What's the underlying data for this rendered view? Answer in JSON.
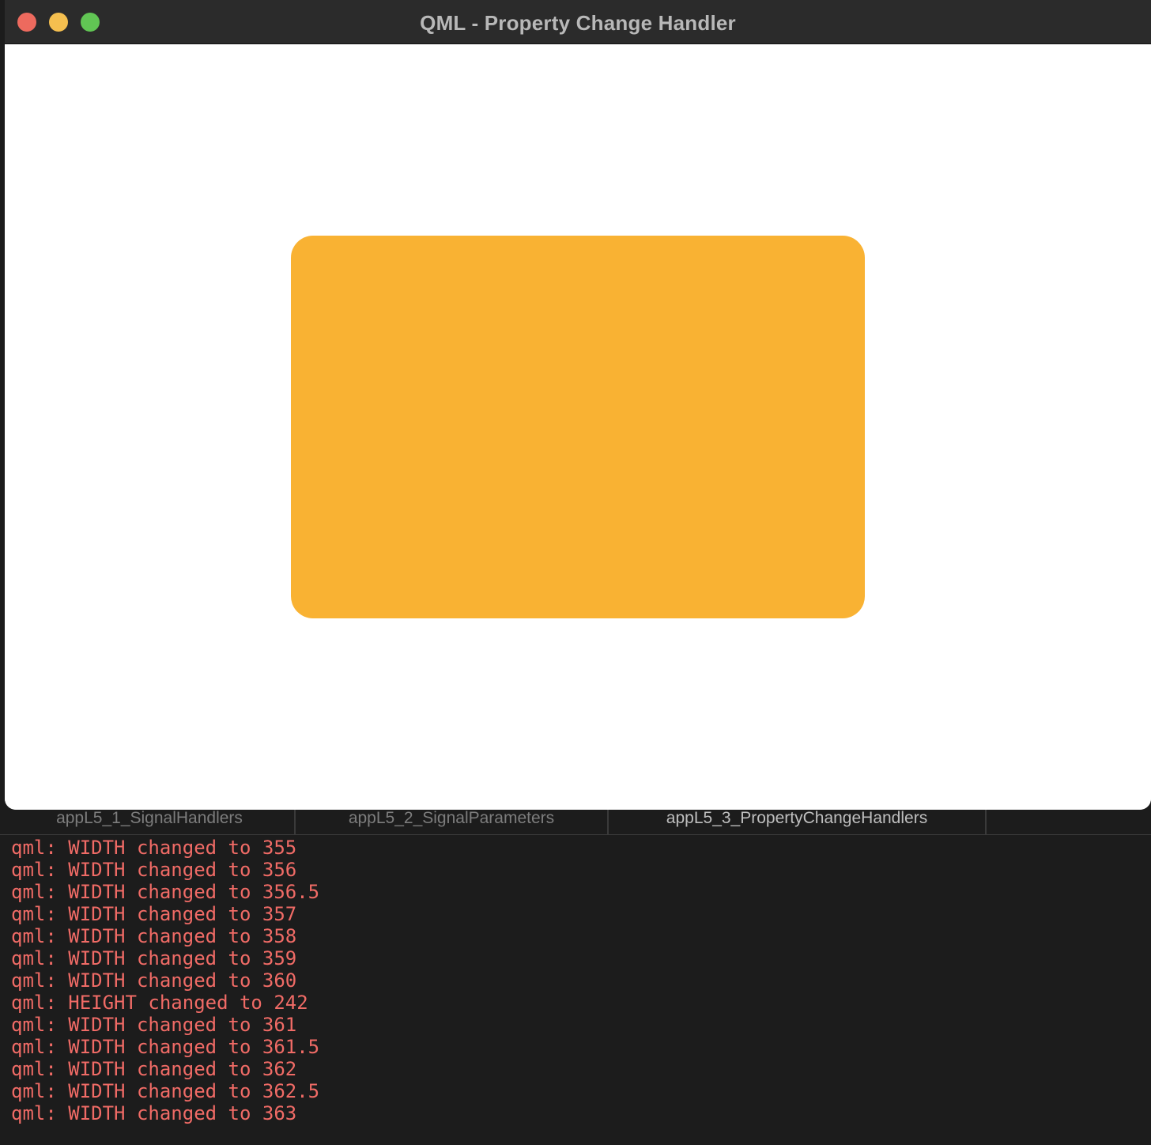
{
  "window": {
    "title": "QML - Property Change Handler"
  },
  "canvas": {
    "rect_color": "#f9b233"
  },
  "tabs": [
    {
      "label": "appL5_1_SignalHandlers",
      "active": false
    },
    {
      "label": "appL5_2_SignalParameters",
      "active": false
    },
    {
      "label": "appL5_3_PropertyChangeHandlers",
      "active": true
    }
  ],
  "console": {
    "text_color": "#f06b66",
    "lines": [
      "qml: WIDTH changed to 355",
      "qml: WIDTH changed to 356",
      "qml: WIDTH changed to 356.5",
      "qml: WIDTH changed to 357",
      "qml: WIDTH changed to 358",
      "qml: WIDTH changed to 359",
      "qml: WIDTH changed to 360",
      "qml: HEIGHT changed to 242",
      "qml: WIDTH changed to 361",
      "qml: WIDTH changed to 361.5",
      "qml: WIDTH changed to 362",
      "qml: WIDTH changed to 362.5",
      "qml: WIDTH changed to 363"
    ]
  }
}
